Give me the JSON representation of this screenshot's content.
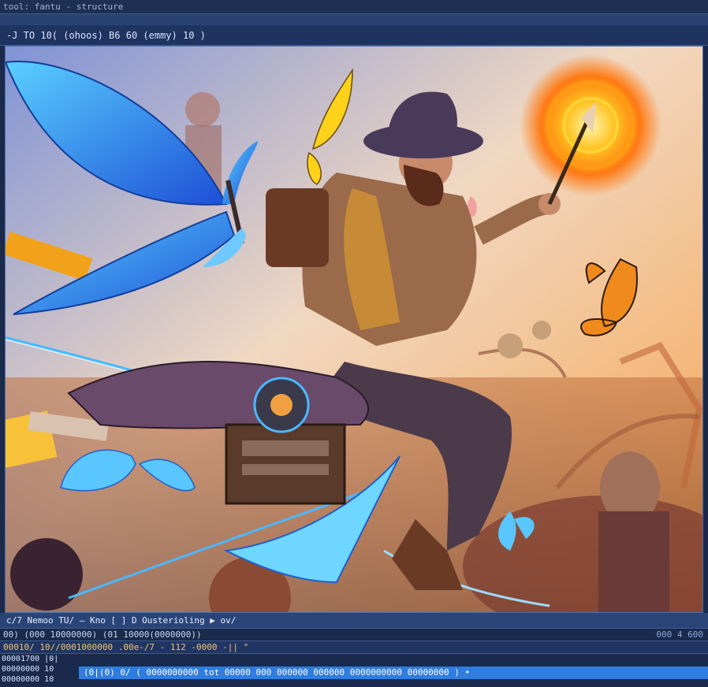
{
  "titlebar": {
    "text": "tool: fantu - structure"
  },
  "toolbar": {
    "text": "-J  TO  10( (ohoos)  B6  60  (emmy)  10 )"
  },
  "status": {
    "row1": "c/7  Nemoo   TU/ —   Kno  [ ]   D  Ousterioling  ▶  ov/",
    "row2": "00)  (000 10000000)  (01 10000(0000000))",
    "row2_right": "000 4   600",
    "row3": "00010/ 10//0001000000 .00e-/7 - 112 -0000 -|| °",
    "row4_lines": [
      "00001700 |0|",
      "00000000 10",
      "00000000 10"
    ],
    "command": "(0|(0)  0/ ( 0000000000 tot 00000 000 000000 000000 0000000000 00000000 ) •"
  },
  "colors": {
    "sun": "#ffb21e",
    "butterfly_blue": "#3aa6ff",
    "monarch": "#f08a1c",
    "sky": "#f3e3c9"
  }
}
